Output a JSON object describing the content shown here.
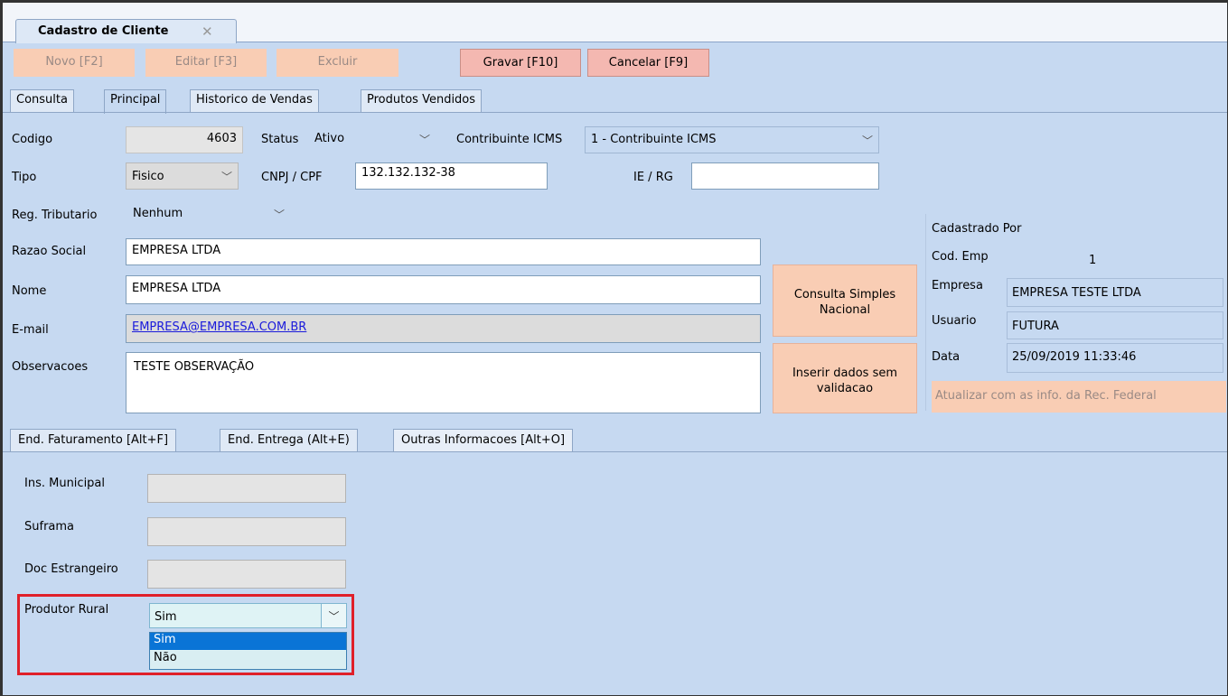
{
  "window": {
    "tab_title": "Cadastro de Cliente",
    "tab_close": "✕"
  },
  "toolbar": {
    "novo": "Novo [F2]",
    "editar": "Editar [F3]",
    "excluir": "Excluir",
    "gravar": "Gravar [F10]",
    "cancelar": "Cancelar [F9]"
  },
  "main_tabs": [
    "Consulta",
    "Principal",
    "Historico de Vendas",
    "Produtos Vendidos"
  ],
  "form": {
    "codigo_label": "Codigo",
    "codigo_value": "4603",
    "status_label": "Status",
    "status_value": "Ativo",
    "icms_label": "Contribuinte ICMS",
    "icms_value": "1 - Contribuinte ICMS",
    "tipo_label": "Tipo",
    "tipo_value": "Fisico",
    "cnpj_label": "CNPJ / CPF",
    "cnpj_value": "132.132.132-38",
    "ie_label": "IE / RG",
    "ie_value": "",
    "reg_label": "Reg. Tributario",
    "reg_value": "Nenhum",
    "razao_label": "Razao Social",
    "razao_value": "EMPRESA LTDA",
    "nome_label": "Nome",
    "nome_value": "EMPRESA LTDA",
    "email_label": "E-mail",
    "email_value": "EMPRESA@EMPRESA.COM.BR",
    "obs_label": "Observacoes",
    "obs_value": "TESTE OBSERVAÇÃO"
  },
  "actions": {
    "consulta_simples_l1": "Consulta Simples",
    "consulta_simples_l2": "Nacional",
    "inserir_l1": "Inserir dados sem",
    "inserir_l2": "validacao"
  },
  "side": {
    "cadastrado_por": "Cadastrado Por",
    "cod_emp_label": "Cod. Emp",
    "cod_emp_value": "1",
    "empresa_label": "Empresa",
    "empresa_value": "EMPRESA TESTE LTDA",
    "usuario_label": "Usuario",
    "usuario_value": "FUTURA",
    "data_label": "Data",
    "data_value": "25/09/2019 11:33:46",
    "atualizar_button": "Atualizar com as info. da Rec. Federal"
  },
  "bottom_tabs": [
    "End. Faturamento [Alt+F]",
    "End. Entrega (Alt+E)",
    "Outras Informacoes [Alt+O]"
  ],
  "outras": {
    "ins_municipal_label": "Ins. Municipal",
    "suframa_label": "Suframa",
    "doc_estrangeiro_label": "Doc Estrangeiro",
    "produtor_rural_label": "Produtor Rural",
    "produtor_rural_value": "Sim",
    "produtor_rural_options": [
      "Sim",
      "Não"
    ]
  },
  "colors": {
    "background": "#c6d9f1",
    "orange_button": "#f9cdb4",
    "active_button": "#f4b8b1",
    "highlight": "#e0202a",
    "selection": "#0a74d6"
  }
}
